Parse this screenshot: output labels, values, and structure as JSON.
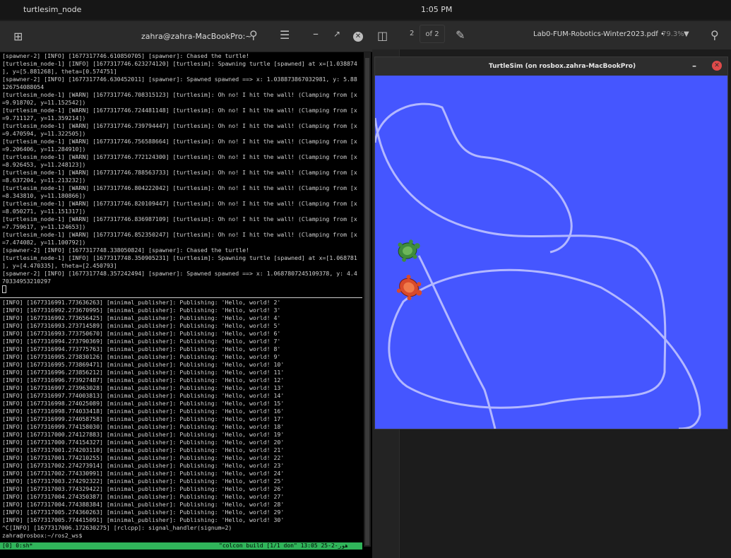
{
  "topbar": {
    "app_name": "turtlesim_node",
    "clock": "1:05 PM"
  },
  "terminal": {
    "title": "zahra@zahra-MacBookPro:~",
    "pane1_lines": [
      "[spawner-2] [INFO] [1677317746.610850705] [spawner]: Chased the turtle!",
      "[turtlesim_node-1] [INFO] [1677317746.623274120] [turtlesim]: Spawning turtle [spawned] at x=[1.038874",
      "], y=[5.881268], theta=[0.574751]",
      "[spawner-2] [INFO] [1677317746.630452011] [spawner]: Spawned spawned ==> x: 1.038873867032981, y: 5.88",
      "126754088054",
      "[turtlesim_node-1] [WARN] [1677317746.708315123] [turtlesim]: Oh no! I hit the wall! (Clamping from [x",
      "=9.918702, y=11.152542])",
      "[turtlesim_node-1] [WARN] [1677317746.724481148] [turtlesim]: Oh no! I hit the wall! (Clamping from [x",
      "=9.711127, y=11.359214])",
      "[turtlesim_node-1] [WARN] [1677317746.739794447] [turtlesim]: Oh no! I hit the wall! (Clamping from [x",
      "=9.470594, y=11.322505])",
      "[turtlesim_node-1] [WARN] [1677317746.756588664] [turtlesim]: Oh no! I hit the wall! (Clamping from [x",
      "=9.206406, y=11.284910])",
      "[turtlesim_node-1] [WARN] [1677317746.772124300] [turtlesim]: Oh no! I hit the wall! (Clamping from [x",
      "=8.926453, y=11.248123])",
      "[turtlesim_node-1] [WARN] [1677317746.788563733] [turtlesim]: Oh no! I hit the wall! (Clamping from [x",
      "=8.637204, y=11.213232])",
      "[turtlesim_node-1] [WARN] [1677317746.804222042] [turtlesim]: Oh no! I hit the wall! (Clamping from [x",
      "=8.343810, y=11.180866])",
      "[turtlesim_node-1] [WARN] [1677317746.820109447] [turtlesim]: Oh no! I hit the wall! (Clamping from [x",
      "=8.050271, y=11.151317])",
      "[turtlesim_node-1] [WARN] [1677317746.836987109] [turtlesim]: Oh no! I hit the wall! (Clamping from [x",
      "=7.759617, y=11.124653])",
      "[turtlesim_node-1] [WARN] [1677317746.852350247] [turtlesim]: Oh no! I hit the wall! (Clamping from [x",
      "=7.474082, y=11.100792])",
      "[spawner-2] [INFO] [1677317748.338050824] [spawner]: Chased the turtle!",
      "[turtlesim_node-1] [INFO] [1677317748.350905231] [turtlesim]: Spawning turtle [spawned] at x=[1.068781",
      "], y=[4.470335], theta=[2.450793]",
      "[spawner-2] [INFO] [1677317748.357242494] [spawner]: Spawned spawned ==> x: 1.0687807245109378, y: 4.4",
      "70334953210297"
    ],
    "pane2_lines": [
      "[INFO] [1677316991.773636263] [minimal_publisher]: Publishing: 'Hello, world! 2'",
      "[INFO] [1677316992.273670995] [minimal_publisher]: Publishing: 'Hello, world! 3'",
      "[INFO] [1677316992.773656425] [minimal_publisher]: Publishing: 'Hello, world! 4'",
      "[INFO] [1677316993.273714589] [minimal_publisher]: Publishing: 'Hello, world! 5'",
      "[INFO] [1677316993.773750670] [minimal_publisher]: Publishing: 'Hello, world! 6'",
      "[INFO] [1677316994.273790369] [minimal_publisher]: Publishing: 'Hello, world! 7'",
      "[INFO] [1677316994.773775763] [minimal_publisher]: Publishing: 'Hello, world! 8'",
      "[INFO] [1677316995.273830126] [minimal_publisher]: Publishing: 'Hello, world! 9'",
      "[INFO] [1677316995.773869471] [minimal_publisher]: Publishing: 'Hello, world! 10'",
      "[INFO] [1677316996.273856212] [minimal_publisher]: Publishing: 'Hello, world! 11'",
      "[INFO] [1677316996.773927487] [minimal_publisher]: Publishing: 'Hello, world! 12'",
      "[INFO] [1677316997.273963028] [minimal_publisher]: Publishing: 'Hello, world! 13'",
      "[INFO] [1677316997.774003813] [minimal_publisher]: Publishing: 'Hello, world! 14'",
      "[INFO] [1677316998.274025089] [minimal_publisher]: Publishing: 'Hello, world! 15'",
      "[INFO] [1677316998.774033418] [minimal_publisher]: Publishing: 'Hello, world! 16'",
      "[INFO] [1677316999.274058758] [minimal_publisher]: Publishing: 'Hello, world! 17'",
      "[INFO] [1677316999.774158030] [minimal_publisher]: Publishing: 'Hello, world! 18'",
      "[INFO] [1677317000.274127883] [minimal_publisher]: Publishing: 'Hello, world! 19'",
      "[INFO] [1677317000.774154327] [minimal_publisher]: Publishing: 'Hello, world! 20'",
      "[INFO] [1677317001.274203110] [minimal_publisher]: Publishing: 'Hello, world! 21'",
      "[INFO] [1677317001.774210255] [minimal_publisher]: Publishing: 'Hello, world! 22'",
      "[INFO] [1677317002.274273914] [minimal_publisher]: Publishing: 'Hello, world! 23'",
      "[INFO] [1677317002.774330991] [minimal_publisher]: Publishing: 'Hello, world! 24'",
      "[INFO] [1677317003.274292322] [minimal_publisher]: Publishing: 'Hello, world! 25'",
      "[INFO] [1677317003.774329422] [minimal_publisher]: Publishing: 'Hello, world! 26'",
      "[INFO] [1677317004.274350387] [minimal_publisher]: Publishing: 'Hello, world! 27'",
      "[INFO] [1677317004.774388384] [minimal_publisher]: Publishing: 'Hello, world! 28'",
      "[INFO] [1677317005.274360263] [minimal_publisher]: Publishing: 'Hello, world! 29'",
      "[INFO] [1677317005.774415091] [minimal_publisher]: Publishing: 'Hello, world! 30'",
      "^C[INFO] [1677317006.172630275] [rclcpp]: signal_handler(signum=2)",
      "zahra@rosbox:~/ros2_ws$"
    ],
    "status_left": "[0] 0:sh*",
    "status_right": "\"colcon build [1/1 don\" 13:05 25-2-هور",
    "status_color": "#30b45a"
  },
  "pdf": {
    "page_input": "2",
    "page_of": "of 2",
    "file_name": "Lab0-FUM-Robotics-Winter2023.pdf •",
    "zoom": "79.3%"
  },
  "turtlesim": {
    "title": "TurtleSim (on rosbox.zahra-MacBookPro)",
    "background_color": "#4556ff",
    "pen_color": "#b3b8ff"
  }
}
